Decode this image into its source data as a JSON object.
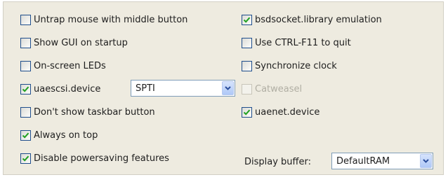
{
  "left_options": [
    {
      "label": "Untrap mouse with middle button",
      "checked": false
    },
    {
      "label": "Show GUI on startup",
      "checked": false
    },
    {
      "label": "On-screen LEDs",
      "checked": false
    },
    {
      "label": "uaescsi.device",
      "checked": true
    },
    {
      "label": "Don't show taskbar button",
      "checked": false
    },
    {
      "label": "Always on top",
      "checked": true
    },
    {
      "label": "Disable powersaving features",
      "checked": true
    }
  ],
  "right_options": [
    {
      "label": "bsdsocket.library emulation",
      "checked": true
    },
    {
      "label": "Use CTRL-F11 to quit",
      "checked": false
    },
    {
      "label": "Synchronize clock",
      "checked": false
    },
    {
      "label": "Catweasel",
      "checked": false,
      "disabled": true
    },
    {
      "label": "uaenet.device",
      "checked": true
    }
  ],
  "scsi_select": {
    "value": "SPTI"
  },
  "display_buffer": {
    "label": "Display buffer:",
    "value": "DefaultRAM"
  },
  "icons": {
    "check": "check-icon",
    "dropdown": "chevron-down-icon"
  },
  "colors": {
    "panel_bg": "#eeebe0",
    "checkbox_border": "#1f4e8c",
    "check": "#21a121",
    "disabled_text": "#b0aea3"
  }
}
